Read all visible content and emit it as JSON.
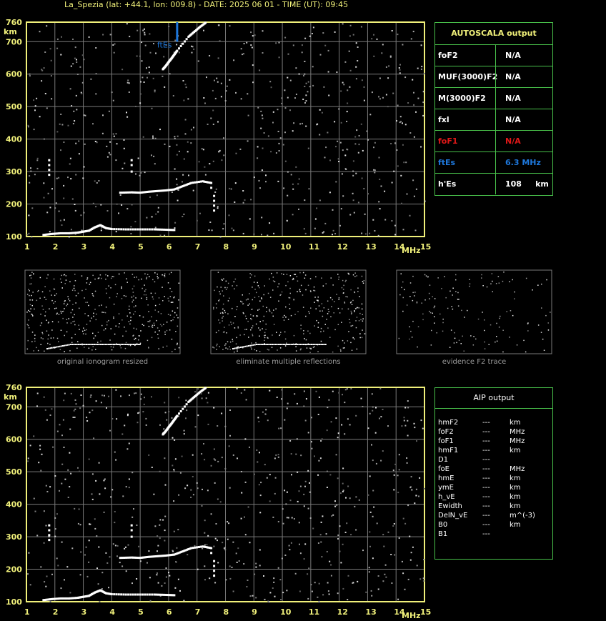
{
  "header": {
    "title": "La_Spezia (lat: +44.1, lon: 009.8) - DATE: 2025 06 01 - TIME (UT): 09:45"
  },
  "colors": {
    "axis": "#f0f07a",
    "grid": "#7a7a7a",
    "panel_border": "#48c04a",
    "fte": "#1e78dc",
    "fof1": "#e01818",
    "label": "#ffffff"
  },
  "autoscala": {
    "title": "AUTOSCALA output",
    "rows": [
      {
        "label": "foF2",
        "value": "N/A",
        "color": "#ffffff"
      },
      {
        "label": "MUF(3000)F2",
        "value": "N/A",
        "color": "#ffffff"
      },
      {
        "label": "M(3000)F2",
        "value": "N/A",
        "color": "#ffffff"
      },
      {
        "label": "fxl",
        "value": "N/A",
        "color": "#ffffff"
      },
      {
        "label": "foF1",
        "value": "N/A",
        "color": "#e01818"
      },
      {
        "label": "ftEs",
        "value": "6.3 MHz",
        "color": "#1e78dc"
      },
      {
        "label": "h'Es",
        "value": "108     km",
        "color": "#ffffff"
      }
    ]
  },
  "aip": {
    "title": "AIP output",
    "rows": [
      {
        "param": "hmF2",
        "value": "---",
        "unit": "km"
      },
      {
        "param": "foF2",
        "value": "---",
        "unit": "MHz"
      },
      {
        "param": "foF1",
        "value": "---",
        "unit": "MHz"
      },
      {
        "param": "hmF1",
        "value": "---",
        "unit": "km"
      },
      {
        "param": "D1",
        "value": "---",
        "unit": ""
      },
      {
        "param": "foE",
        "value": "---",
        "unit": "MHz"
      },
      {
        "param": "hmE",
        "value": "---",
        "unit": "km"
      },
      {
        "param": "ymE",
        "value": "---",
        "unit": "km"
      },
      {
        "param": "h_vE",
        "value": "---",
        "unit": "km"
      },
      {
        "param": "Ewidth",
        "value": "---",
        "unit": "km"
      },
      {
        "param": "DelN_vE",
        "value": "---",
        "unit": "m^(-3)"
      },
      {
        "param": "B0",
        "value": "---",
        "unit": "km"
      },
      {
        "param": "B1",
        "value": "---",
        "unit": ""
      }
    ]
  },
  "thumbnails": [
    {
      "caption": "original ionogram resized"
    },
    {
      "caption": "eliminate multiple reflections"
    },
    {
      "caption": "evidence F2 trace"
    }
  ],
  "chart_data": [
    {
      "type": "scatter",
      "title": "",
      "xlabel": "MHz",
      "ylabel": "km",
      "xlim": [
        1,
        15
      ],
      "ylim": [
        100,
        760
      ],
      "x_ticks": [
        1,
        2,
        3,
        4,
        5,
        6,
        7,
        8,
        9,
        10,
        11,
        12,
        13,
        14,
        15
      ],
      "y_ticks": [
        100,
        200,
        300,
        400,
        500,
        600,
        700,
        760
      ],
      "annotation": {
        "label": "ftEs",
        "x": 6.3,
        "y_range": [
          700,
          760
        ]
      },
      "series": [
        {
          "points": [
            [
              1.6,
              105
            ],
            [
              1.9,
              108
            ],
            [
              2.2,
              110
            ],
            [
              2.5,
              110
            ],
            [
              2.8,
              112
            ],
            [
              3.0,
              115
            ],
            [
              3.2,
              118
            ],
            [
              3.4,
              128
            ],
            [
              3.6,
              135
            ],
            [
              3.8,
              126
            ],
            [
              4.0,
              123
            ],
            [
              4.5,
              122
            ],
            [
              5.0,
              122
            ],
            [
              5.5,
              122
            ],
            [
              5.9,
              121
            ],
            [
              6.2,
              120
            ]
          ]
        },
        {
          "points": [
            [
              4.3,
              235
            ],
            [
              4.7,
              236
            ],
            [
              5.0,
              235
            ],
            [
              5.3,
              238
            ],
            [
              5.6,
              240
            ],
            [
              5.9,
              242
            ],
            [
              6.2,
              245
            ],
            [
              6.5,
              255
            ],
            [
              6.8,
              265
            ],
            [
              7.2,
              270
            ],
            [
              7.5,
              265
            ]
          ]
        },
        {
          "points": [
            [
              5.8,
              615
            ],
            [
              5.9,
              625
            ],
            [
              6.0,
              637
            ],
            [
              6.1,
              648
            ],
            [
              6.2,
              660
            ],
            [
              6.3,
              672
            ],
            [
              6.7,
              715
            ],
            [
              6.9,
              730
            ],
            [
              7.1,
              745
            ],
            [
              7.3,
              758
            ]
          ]
        },
        {
          "points": [
            [
              1.8,
              290
            ],
            [
              1.8,
              305
            ],
            [
              1.8,
              320
            ],
            [
              1.8,
              335
            ],
            [
              4.7,
              300
            ],
            [
              4.7,
              320
            ],
            [
              4.7,
              335
            ],
            [
              7.6,
              180
            ],
            [
              7.6,
              195
            ],
            [
              7.6,
              210
            ],
            [
              7.6,
              225
            ],
            [
              7.5,
              250
            ]
          ]
        }
      ]
    },
    {
      "type": "scatter",
      "title": "",
      "xlabel": "MHz",
      "ylabel": "km",
      "xlim": [
        1,
        15
      ],
      "ylim": [
        100,
        760
      ],
      "x_ticks": [
        1,
        2,
        3,
        4,
        5,
        6,
        7,
        8,
        9,
        10,
        11,
        12,
        13,
        14,
        15
      ],
      "y_ticks": [
        100,
        200,
        300,
        400,
        500,
        600,
        700,
        760
      ],
      "series": [
        {
          "points": [
            [
              1.6,
              105
            ],
            [
              1.9,
              108
            ],
            [
              2.2,
              110
            ],
            [
              2.5,
              110
            ],
            [
              2.8,
              112
            ],
            [
              3.0,
              115
            ],
            [
              3.2,
              118
            ],
            [
              3.4,
              128
            ],
            [
              3.6,
              135
            ],
            [
              3.8,
              126
            ],
            [
              4.0,
              123
            ],
            [
              4.5,
              122
            ],
            [
              5.0,
              122
            ],
            [
              5.5,
              122
            ],
            [
              5.9,
              121
            ],
            [
              6.2,
              120
            ]
          ]
        },
        {
          "points": [
            [
              4.3,
              235
            ],
            [
              4.7,
              236
            ],
            [
              5.0,
              235
            ],
            [
              5.3,
              238
            ],
            [
              5.6,
              240
            ],
            [
              5.9,
              242
            ],
            [
              6.2,
              245
            ],
            [
              6.5,
              255
            ],
            [
              6.8,
              265
            ],
            [
              7.2,
              270
            ],
            [
              7.5,
              265
            ]
          ]
        },
        {
          "points": [
            [
              5.8,
              615
            ],
            [
              5.9,
              625
            ],
            [
              6.0,
              637
            ],
            [
              6.1,
              648
            ],
            [
              6.2,
              660
            ],
            [
              6.3,
              672
            ],
            [
              6.7,
              715
            ],
            [
              6.9,
              730
            ],
            [
              7.1,
              745
            ],
            [
              7.3,
              758
            ]
          ]
        },
        {
          "points": [
            [
              1.8,
              290
            ],
            [
              1.8,
              305
            ],
            [
              1.8,
              320
            ],
            [
              1.8,
              335
            ],
            [
              4.7,
              300
            ],
            [
              4.7,
              320
            ],
            [
              4.7,
              335
            ],
            [
              7.6,
              180
            ],
            [
              7.6,
              195
            ],
            [
              7.6,
              210
            ],
            [
              7.6,
              225
            ],
            [
              7.5,
              250
            ]
          ]
        }
      ]
    }
  ]
}
